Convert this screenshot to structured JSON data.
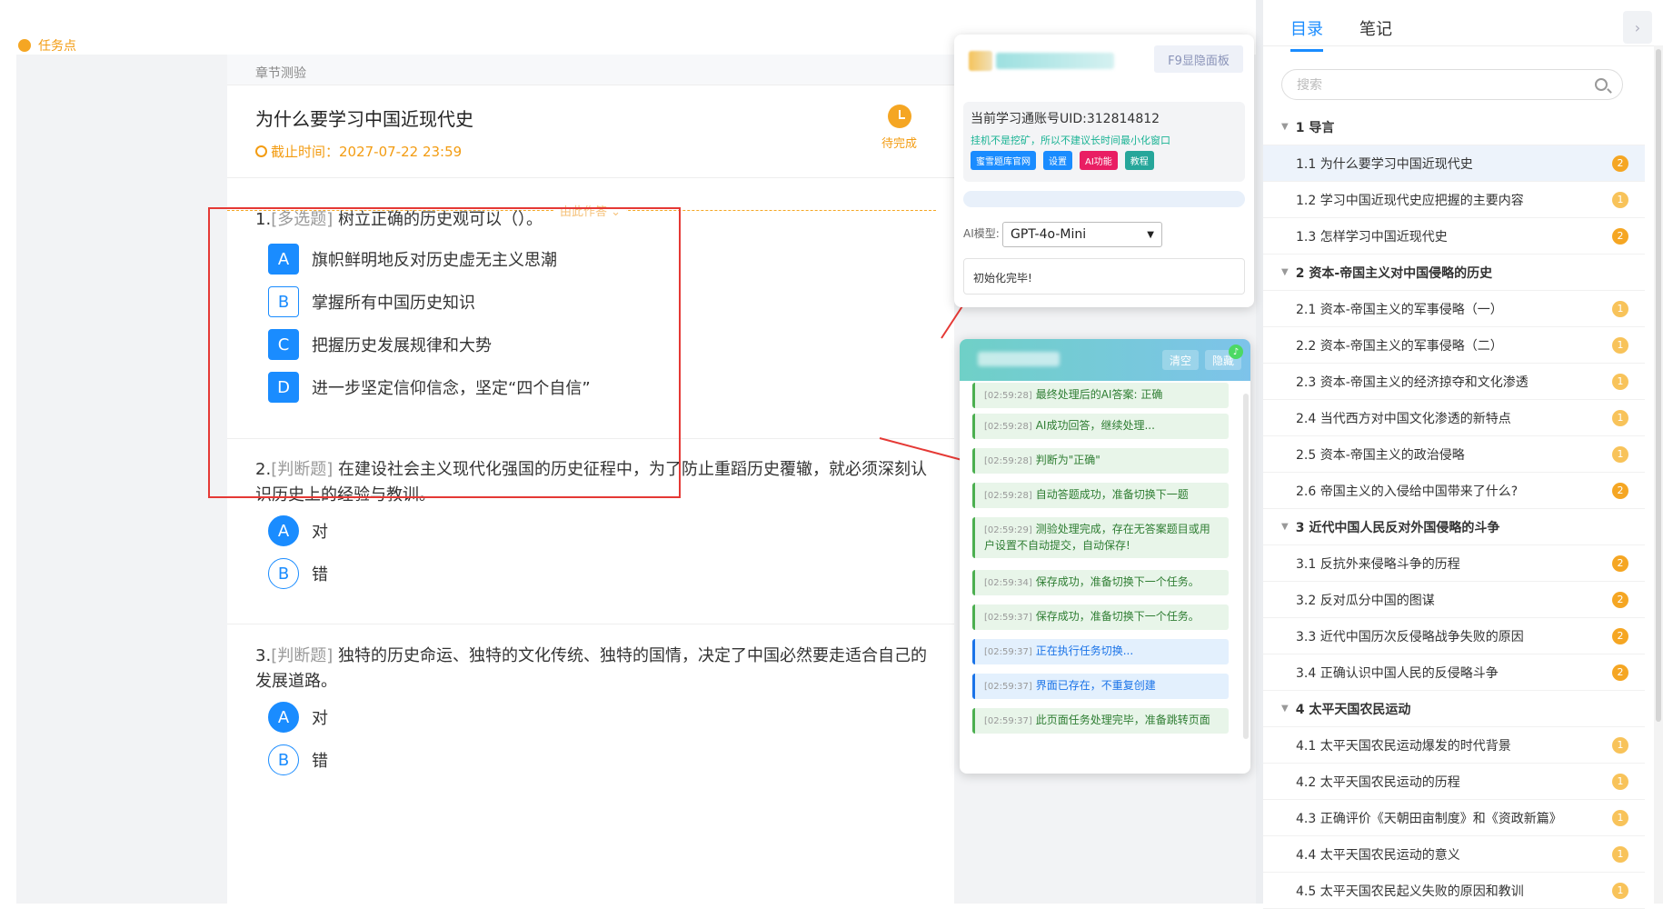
{
  "top": {
    "task_point": "任务点"
  },
  "quiz": {
    "chapter_label": "章节测验",
    "title": "为什么要学习中国近现代史",
    "deadline": "截止时间：2027-07-22 23:59",
    "status": "待完成",
    "collapse_label": "由此作答"
  },
  "questions": [
    {
      "number": "1.",
      "type": "[多选题]",
      "text": "树立正确的历史观可以（）。",
      "options": [
        {
          "letter": "A",
          "text": "旗帜鲜明地反对历史虚无主义思潮",
          "selected": true
        },
        {
          "letter": "B",
          "text": "掌握所有中国历史知识",
          "selected": false
        },
        {
          "letter": "C",
          "text": "把握历史发展规律和大势",
          "selected": true
        },
        {
          "letter": "D",
          "text": "进一步坚定信仰信念，坚定“四个自信”",
          "selected": true
        }
      ]
    },
    {
      "number": "2.",
      "type": "[判断题]",
      "text": "在建设社会主义现代化强国的历史征程中，为了防止重蹈历史覆辙，就必须深刻认识历史上的经验与教训。",
      "options": [
        {
          "letter": "A",
          "text": "对",
          "selected": true
        },
        {
          "letter": "B",
          "text": "错",
          "selected": false
        }
      ]
    },
    {
      "number": "3.",
      "type": "[判断题]",
      "text": "独特的历史命运、独特的文化传统、独特的国情，决定了中国必然要走适合自己的发展道路。",
      "options": [
        {
          "letter": "A",
          "text": "对",
          "selected": true
        },
        {
          "letter": "B",
          "text": "错",
          "selected": false
        }
      ]
    }
  ],
  "helper": {
    "f9_button": "F9显隐面板",
    "uid": "当前学习通账号UID:312814812",
    "warning": "挂机不是挖矿，所以不建议长时间最小化窗口",
    "pills": [
      {
        "label": "蜜雪题库官网",
        "color": "#1a8cff"
      },
      {
        "label": "设置",
        "color": "#1a8cff"
      },
      {
        "label": "AI功能",
        "color": "#e91e63"
      },
      {
        "label": "教程",
        "color": "#26a69a"
      }
    ],
    "model_label": "AI模型:",
    "model_value": "GPT-4o-Mini",
    "init_text": "初始化完毕!"
  },
  "log": {
    "clear_button": "清空",
    "hide_button": "隐藏",
    "entries": [
      {
        "time": "[02:59:28]",
        "text": "最终处理后的AI答案: 正确",
        "kind": "green"
      },
      {
        "time": "[02:59:28]",
        "text": "AI成功回答，继续处理...",
        "kind": "green"
      },
      {
        "time": "[02:59:28]",
        "text": "判断为\"正确\"",
        "kind": "green"
      },
      {
        "time": "[02:59:28]",
        "text": "自动答题成功，准备切换下一题",
        "kind": "green"
      },
      {
        "time": "[02:59:29]",
        "text": "测验处理完成，存在无答案题目或用户设置不自动提交，自动保存!",
        "kind": "green"
      },
      {
        "time": "[02:59:34]",
        "text": "保存成功，准备切换下一个任务。",
        "kind": "green"
      },
      {
        "time": "[02:59:37]",
        "text": "保存成功，准备切换下一个任务。",
        "kind": "green"
      },
      {
        "time": "[02:59:37]",
        "text": "正在执行任务切换...",
        "kind": "blue"
      },
      {
        "time": "[02:59:37]",
        "text": "界面已存在，不重复创建",
        "kind": "blue"
      },
      {
        "time": "[02:59:37]",
        "text": "此页面任务处理完毕，准备跳转页面",
        "kind": "green"
      }
    ]
  },
  "sidebar": {
    "tabs": [
      "目录",
      "笔记"
    ],
    "toggle_glyph": "›",
    "search_placeholder": "搜索",
    "toc": [
      {
        "kind": "section",
        "label": "1 导言"
      },
      {
        "kind": "item",
        "label": "1.1 为什么要学习中国近现代史",
        "badge": "2",
        "current": true
      },
      {
        "kind": "item",
        "label": "1.2 学习中国近现代史应把握的主要内容",
        "badge": "1"
      },
      {
        "kind": "item",
        "label": "1.3 怎样学习中国近现代史",
        "badge": "2"
      },
      {
        "kind": "section",
        "label": "2 资本-帝国主义对中国侵略的历史"
      },
      {
        "kind": "item",
        "label": "2.1 资本-帝国主义的军事侵略（一）",
        "badge": "1"
      },
      {
        "kind": "item",
        "label": "2.2 资本-帝国主义的军事侵略（二）",
        "badge": "1"
      },
      {
        "kind": "item",
        "label": "2.3 资本-帝国主义的经济掠夺和文化渗透",
        "badge": "1"
      },
      {
        "kind": "item",
        "label": "2.4 当代西方对中国文化渗透的新特点",
        "badge": "1"
      },
      {
        "kind": "item",
        "label": "2.5 资本-帝国主义的政治侵略",
        "badge": "1"
      },
      {
        "kind": "item",
        "label": "2.6 帝国主义的入侵给中国带来了什么?",
        "badge": "2"
      },
      {
        "kind": "section",
        "label": "3 近代中国人民反对外国侵略的斗争"
      },
      {
        "kind": "item",
        "label": "3.1 反抗外来侵略斗争的历程",
        "badge": "2"
      },
      {
        "kind": "item",
        "label": "3.2 反对瓜分中国的图谋",
        "badge": "2"
      },
      {
        "kind": "item",
        "label": "3.3 近代中国历次反侵略战争失败的原因",
        "badge": "2"
      },
      {
        "kind": "item",
        "label": "3.4 正确认识中国人民的反侵略斗争",
        "badge": "2"
      },
      {
        "kind": "section",
        "label": "4 太平天国农民运动"
      },
      {
        "kind": "item",
        "label": "4.1 太平天国农民运动爆发的时代背景",
        "badge": "1"
      },
      {
        "kind": "item",
        "label": "4.2 太平天国农民运动的历程",
        "badge": "1"
      },
      {
        "kind": "item",
        "label": "4.3 正确评价《天朝田亩制度》和《资政新篇》",
        "badge": "1"
      },
      {
        "kind": "item",
        "label": "4.4 太平天国农民运动的意义",
        "badge": "1"
      },
      {
        "kind": "item",
        "label": "4.5 太平天国农民起义失败的原因和教训",
        "badge": "1"
      }
    ]
  }
}
